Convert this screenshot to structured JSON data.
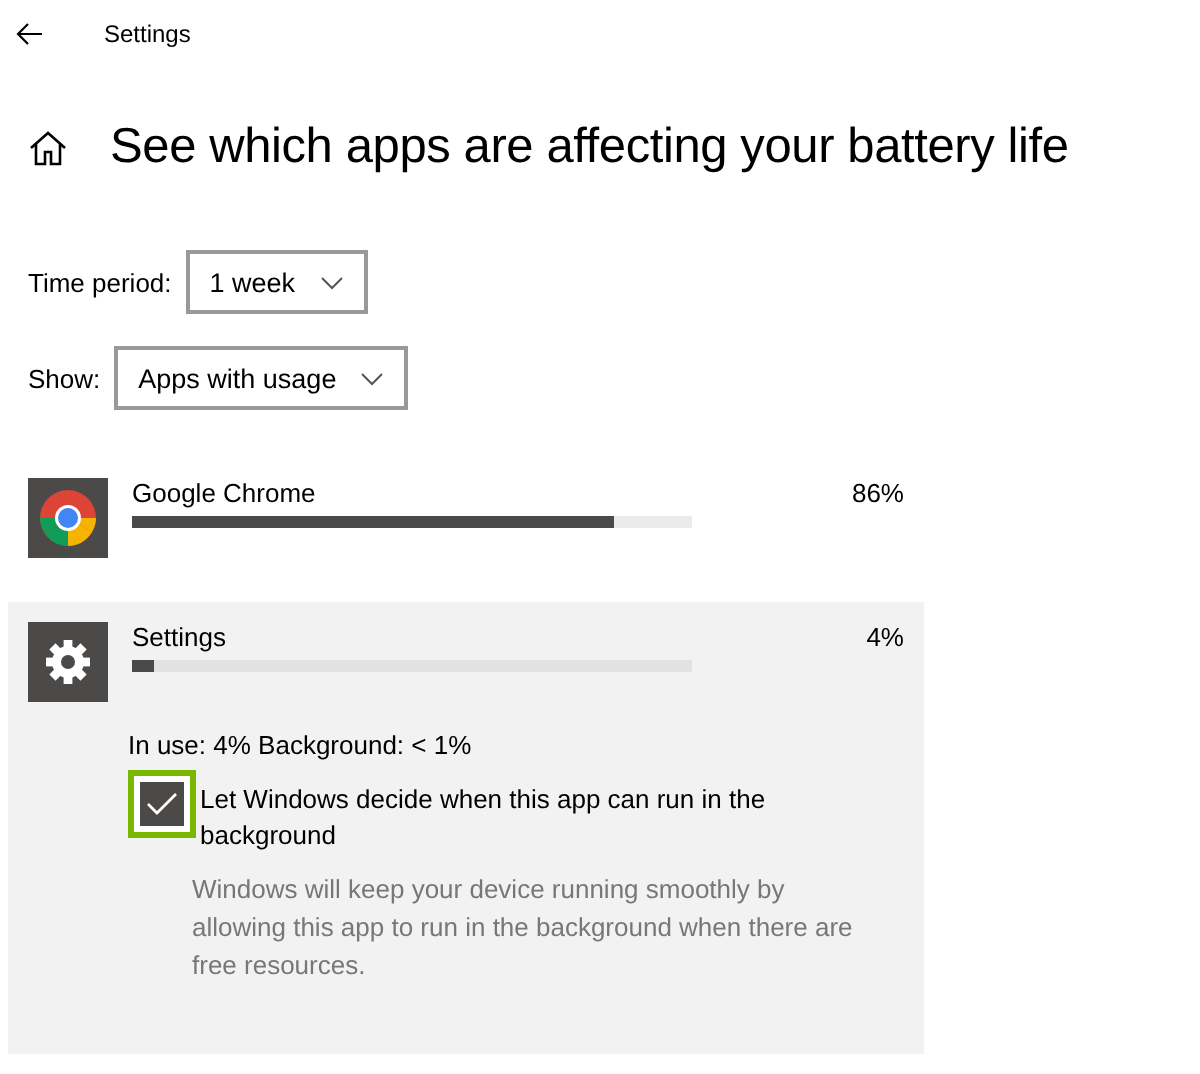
{
  "window": {
    "title": "Settings"
  },
  "page_title": "See which apps are affecting your battery life",
  "filters": [
    {
      "label": "Time period:",
      "value": "1 week"
    },
    {
      "label": "Show:",
      "value": "Apps with usage"
    }
  ],
  "apps": [
    {
      "name": "Google Chrome",
      "kind": "chrome",
      "percent": "86%",
      "level": 0.86,
      "expanded": false
    },
    {
      "name": "Settings",
      "kind": "gear",
      "percent": "4%",
      "level": 0.04,
      "expanded": true,
      "details": "In use: 4% Background: < 1%",
      "option": {
        "label": "Let Windows decide when this app can run in the background",
        "checked": true,
        "highlighted": true,
        "description": "Windows will keep your device running smoothly by allowing this app to run in the background when there are free resources."
      }
    }
  ]
}
